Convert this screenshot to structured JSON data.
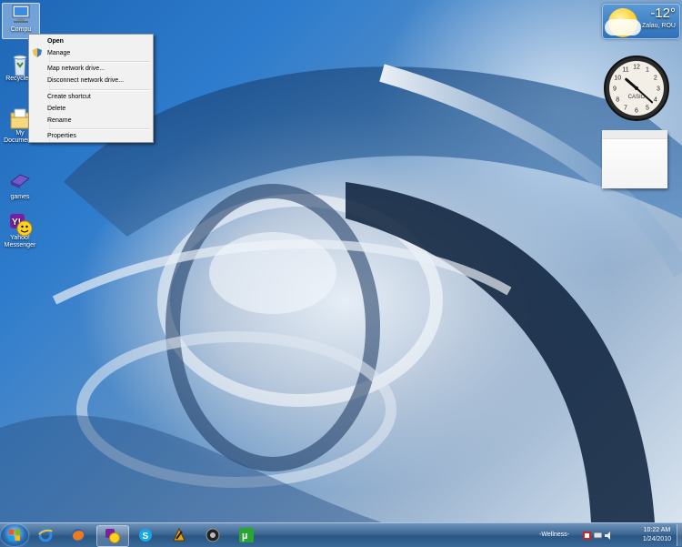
{
  "desktop": {
    "icons": [
      {
        "label": "Compu",
        "icon": "computer-icon"
      },
      {
        "label": "Recycle B",
        "icon": "recycle-bin-icon"
      },
      {
        "label": "My Documen...",
        "icon": "my-documents-icon"
      },
      {
        "label": "games",
        "icon": "games-icon"
      },
      {
        "label": "Yahoo! Messenger",
        "icon": "yahoo-messenger-icon"
      }
    ]
  },
  "context_menu": {
    "items": [
      "Open",
      "Manage",
      "Map network drive...",
      "Disconnect network drive...",
      "Create shortcut",
      "Delete",
      "Rename",
      "Properties"
    ]
  },
  "gadgets": {
    "weather": {
      "temperature": "-12°",
      "location": "Zalau, ROU"
    },
    "clock": {
      "brand": "CASIO",
      "hour": 10,
      "minute": 22
    },
    "notes": {
      "text": ""
    }
  },
  "taskbar": {
    "pinned": [
      "internet-explorer-icon",
      "firefox-icon",
      "yahoo-messenger-icon",
      "skype-icon",
      "winamp-icon",
      "media-player-icon",
      "utorrent-icon"
    ],
    "tray_text": "-Wellness-",
    "time": "10:22 AM",
    "date": "1/24/2010"
  },
  "colors": {
    "menu_bg": "#f1f1f1",
    "taskbar": "#2b5583"
  }
}
